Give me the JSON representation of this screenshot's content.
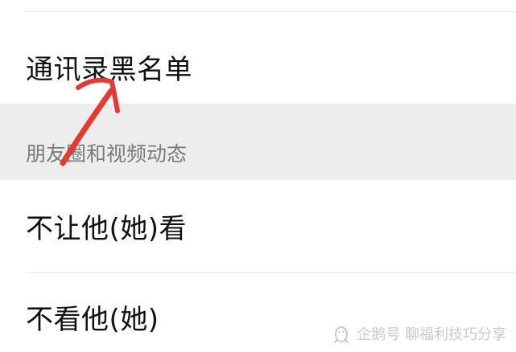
{
  "settings": {
    "blacklist_label": "通讯录黑名单",
    "moments_section_title": "朋友圈和视频动态",
    "hide_moments_label": "不让他(她)看",
    "dont_see_moments_label": "不看他(她)"
  },
  "watermark": {
    "text": "企鹅号 聊福利技巧分享",
    "icon": "penguin-logo-icon"
  },
  "annotation": {
    "icon": "red-arrow-icon",
    "color": "#e23b36"
  }
}
